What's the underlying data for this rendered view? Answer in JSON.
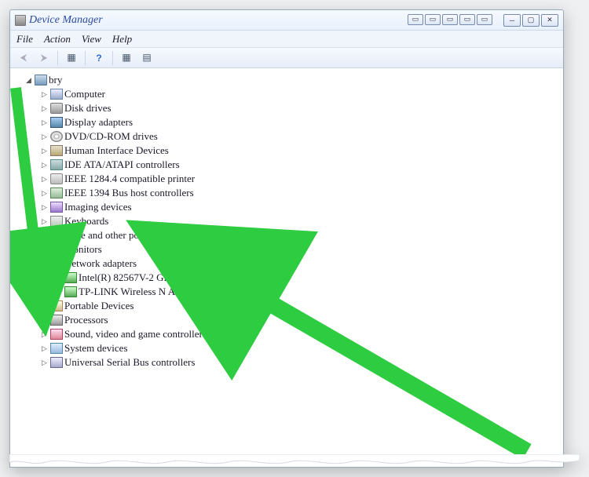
{
  "window": {
    "title": "Device Manager"
  },
  "menu": {
    "file": "File",
    "action": "Action",
    "view": "View",
    "help": "Help"
  },
  "tree": {
    "root": "bry",
    "items": [
      {
        "label": "Computer",
        "icon": "ic-pc"
      },
      {
        "label": "Disk drives",
        "icon": "ic-disk"
      },
      {
        "label": "Display adapters",
        "icon": "ic-display"
      },
      {
        "label": "DVD/CD-ROM drives",
        "icon": "ic-cd"
      },
      {
        "label": "Human Interface Devices",
        "icon": "ic-hid"
      },
      {
        "label": "IDE ATA/ATAPI controllers",
        "icon": "ic-ide"
      },
      {
        "label": "IEEE 1284.4 compatible printer",
        "icon": "ic-printer"
      },
      {
        "label": "IEEE 1394 Bus host controllers",
        "icon": "ic-1394"
      },
      {
        "label": "Imaging devices",
        "icon": "ic-cam"
      },
      {
        "label": "Keyboards",
        "icon": "ic-kb"
      },
      {
        "label": "Mice and other pointing devices",
        "icon": "ic-mouse"
      },
      {
        "label": "Monitors",
        "icon": "ic-mon"
      }
    ],
    "network": {
      "label": "Network adapters",
      "children": [
        "Intel(R) 82567V-2 Gigabit Network Connection",
        "TP-LINK Wireless N Adapter"
      ]
    },
    "items2": [
      {
        "label": "Portable Devices",
        "icon": "ic-port"
      },
      {
        "label": "Processors",
        "icon": "ic-cpu"
      },
      {
        "label": "Sound, video and game controllers",
        "icon": "ic-sound"
      },
      {
        "label": "System devices",
        "icon": "ic-sys"
      },
      {
        "label": "Universal Serial Bus controllers",
        "icon": "ic-usb"
      }
    ]
  }
}
